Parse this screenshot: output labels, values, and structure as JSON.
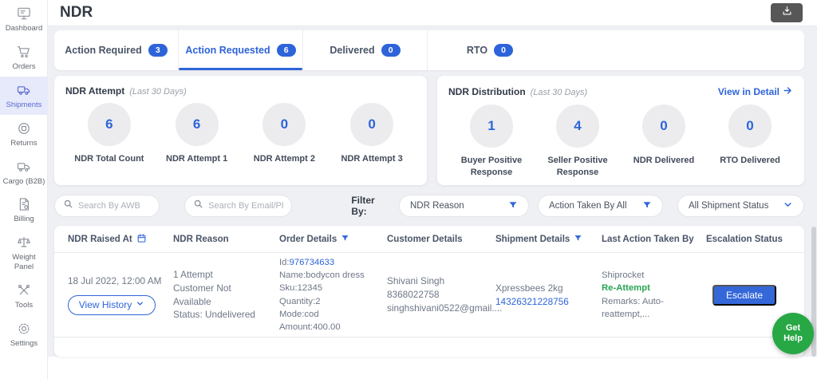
{
  "sidebar": {
    "items": [
      {
        "label": "Dashboard",
        "icon": "dashboard-icon"
      },
      {
        "label": "Orders",
        "icon": "orders-icon"
      },
      {
        "label": "Shipments",
        "icon": "shipments-icon",
        "active": true
      },
      {
        "label": "Returns",
        "icon": "returns-icon"
      },
      {
        "label": "Cargo (B2B)",
        "icon": "cargo-icon"
      },
      {
        "label": "Billing",
        "icon": "billing-icon"
      },
      {
        "label": "Weight Panel",
        "icon": "weight-panel-icon"
      },
      {
        "label": "Tools",
        "icon": "tools-icon"
      },
      {
        "label": "Settings",
        "icon": "settings-icon"
      }
    ]
  },
  "header": {
    "title": "NDR"
  },
  "tabs": [
    {
      "label": "Action Required",
      "count": "3"
    },
    {
      "label": "Action Requested",
      "count": "6"
    },
    {
      "label": "Delivered",
      "count": "0"
    },
    {
      "label": "RTO",
      "count": "0"
    }
  ],
  "summary_cards": {
    "attempt": {
      "title": "NDR Attempt",
      "period": "(Last 30 Days)",
      "stats": [
        {
          "value": "6",
          "label": "NDR Total Count"
        },
        {
          "value": "6",
          "label": "NDR Attempt 1"
        },
        {
          "value": "0",
          "label": "NDR Attempt 2"
        },
        {
          "value": "0",
          "label": "NDR Attempt 3"
        }
      ]
    },
    "distribution": {
      "title": "NDR Distribution",
      "period": "(Last 30 Days)",
      "link_label": "View in Detail",
      "stats": [
        {
          "value": "1",
          "label": "Buyer Positive Response"
        },
        {
          "value": "4",
          "label": "Seller Positive Response"
        },
        {
          "value": "0",
          "label": "NDR Delivered"
        },
        {
          "value": "0",
          "label": "RTO Delivered"
        }
      ]
    }
  },
  "filter_bar": {
    "search_awb_placeholder": "Search By AWB",
    "search_contact_placeholder": "Search By Email/Phone N",
    "filter_by_label": "Filter By:",
    "ndr_reason": "NDR Reason",
    "action_taken": "Action Taken By All",
    "shipment_status": "All Shipment Status"
  },
  "table": {
    "columns": [
      "NDR Raised At",
      "NDR Reason",
      "Order Details",
      "Customer Details",
      "Shipment Details",
      "Last Action Taken By",
      "Escalation Status"
    ],
    "rows": [
      {
        "raised_at": "18 Jul 2022, 12:00 AM",
        "view_history_label": "View History",
        "attempt": "1 Attempt",
        "reason": "Customer Not Available",
        "status": "Status: Undelivered",
        "order_id_label": "Id:",
        "order_id": "976734633",
        "order_name": "Name:bodycon dress",
        "order_sku": "Sku:12345",
        "order_qty": "Quantity:2",
        "order_mode": "Mode:cod",
        "order_amount": "Amount:400.00",
        "customer_name": "Shivani Singh",
        "customer_phone": "8368022758",
        "customer_email": "singhshivani0522@gmail....",
        "courier": "Xpressbees 2kg",
        "awb": "14326321228756",
        "action_by": "Shiprocket",
        "action_type": "Re-Attempt",
        "action_remarks": "Remarks: Auto-reattempt,...",
        "escalate_label": "Escalate"
      }
    ]
  },
  "help_button": {
    "line1": "Get",
    "line2": "Help"
  },
  "colors": {
    "accent_blue": "#2e64d9",
    "sidebar_active": "#5a6ad0",
    "reattempt_green": "#27a352",
    "help_green": "#28a745",
    "page_background": "#eef0f4"
  }
}
